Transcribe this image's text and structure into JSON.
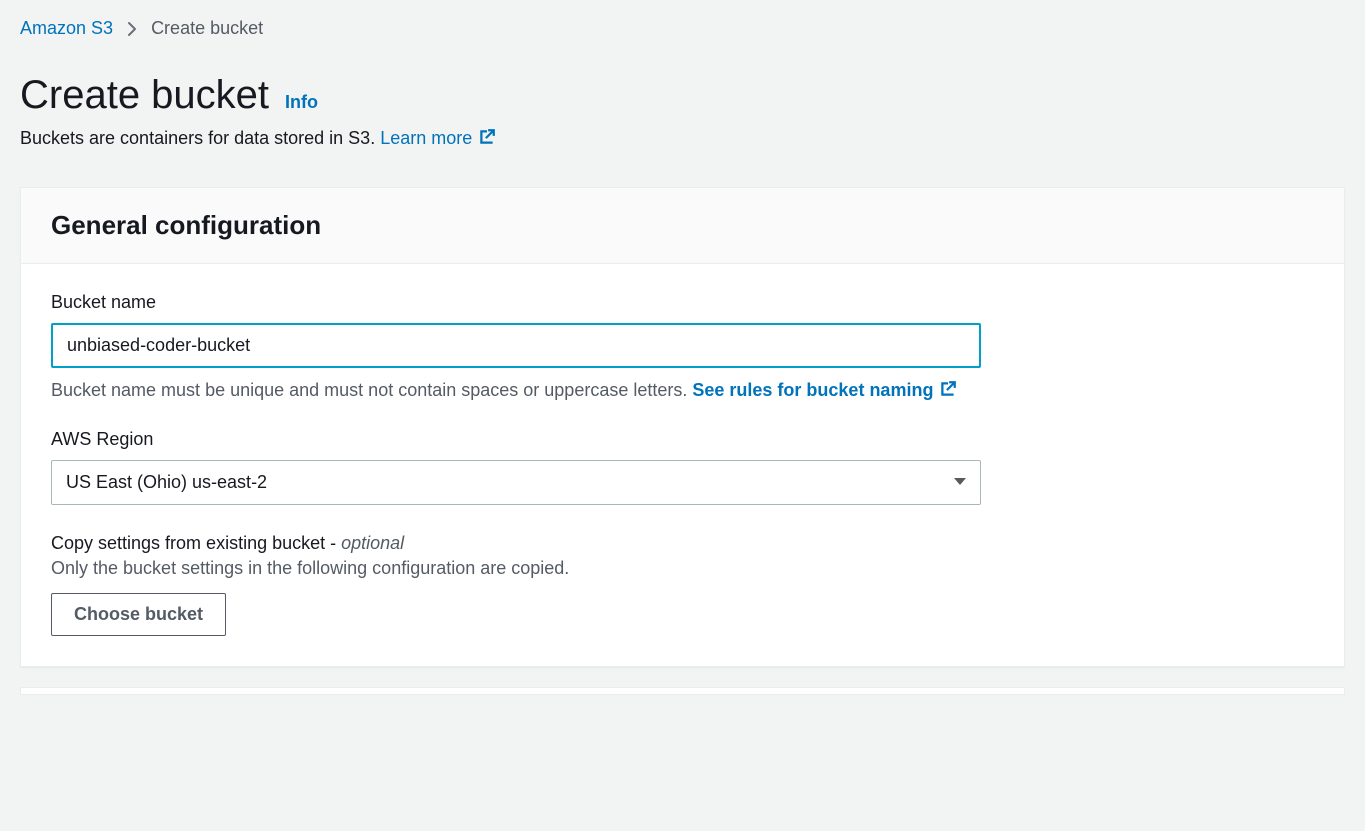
{
  "breadcrumb": {
    "root": "Amazon S3",
    "current": "Create bucket"
  },
  "header": {
    "title": "Create bucket",
    "info": "Info",
    "description": "Buckets are containers for data stored in S3. ",
    "learn_more": "Learn more"
  },
  "panel": {
    "title": "General configuration",
    "bucket_name": {
      "label": "Bucket name",
      "value": "unbiased-coder-bucket",
      "help": "Bucket name must be unique and must not contain spaces or uppercase letters. ",
      "rules_link": "See rules for bucket naming"
    },
    "region": {
      "label": "AWS Region",
      "value": "US East (Ohio) us-east-2"
    },
    "copy": {
      "label_prefix": "Copy settings from existing bucket - ",
      "optional": "optional",
      "help": "Only the bucket settings in the following configuration are copied.",
      "button": "Choose bucket"
    }
  }
}
